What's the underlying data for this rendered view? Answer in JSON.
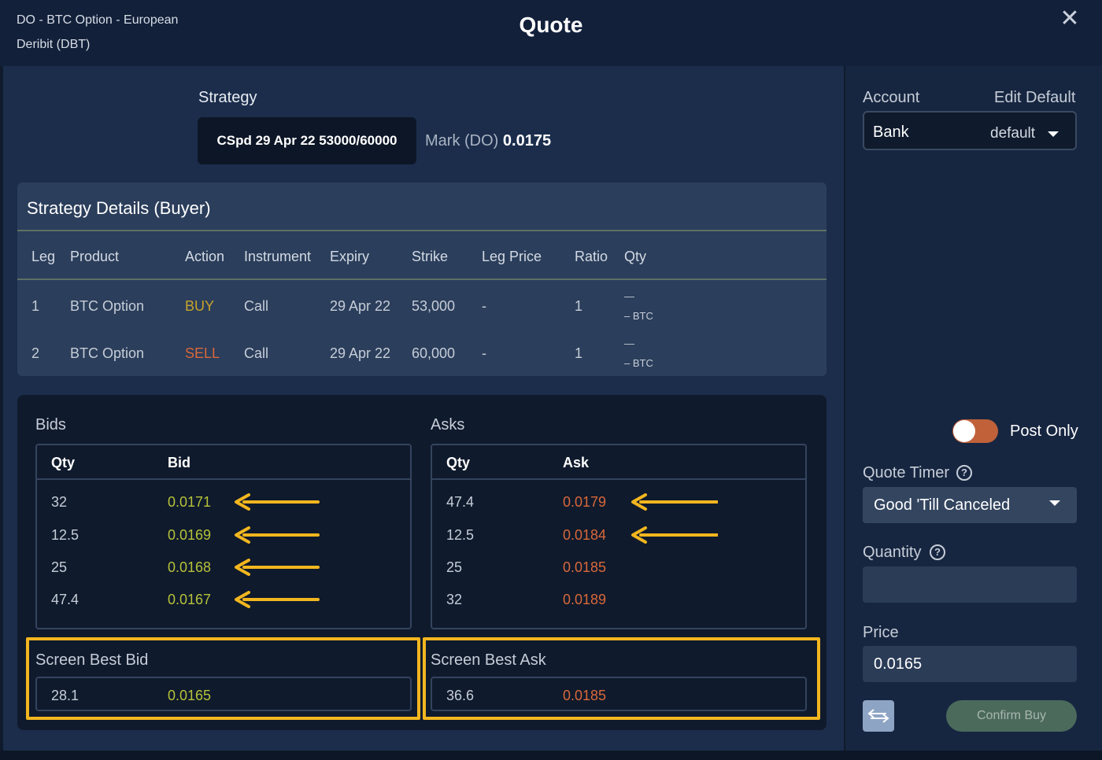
{
  "header": {
    "line1": "DO - BTC Option - European",
    "line2": "Deribit (DBT)",
    "title": "Quote",
    "close_icon": "close-icon"
  },
  "strategy": {
    "label": "Strategy",
    "name": "CSpd 29 Apr 22 53000/60000",
    "mark_label": "Mark (DO)",
    "mark_value": "0.0175"
  },
  "details": {
    "title": "Strategy Details (Buyer)",
    "columns": [
      "Leg",
      "Product",
      "Action",
      "Instrument",
      "Expiry",
      "Strike",
      "Leg Price",
      "Ratio",
      "Qty"
    ],
    "rows": [
      {
        "leg": "1",
        "product": "BTC Option",
        "action": "BUY",
        "instrument": "Call",
        "expiry": "29 Apr 22",
        "strike": "53,000",
        "leg_price": "-",
        "ratio": "1",
        "qty_top": "—",
        "qty_bottom": "– BTC"
      },
      {
        "leg": "2",
        "product": "BTC Option",
        "action": "SELL",
        "instrument": "Call",
        "expiry": "29 Apr 22",
        "strike": "60,000",
        "leg_price": "-",
        "ratio": "1",
        "qty_top": "—",
        "qty_bottom": "– BTC"
      }
    ]
  },
  "bids": {
    "title": "Bids",
    "qty_header": "Qty",
    "price_header": "Bid",
    "rows": [
      {
        "qty": "32",
        "price": "0.0171"
      },
      {
        "qty": "12.5",
        "price": "0.0169"
      },
      {
        "qty": "25",
        "price": "0.0168"
      },
      {
        "qty": "47.4",
        "price": "0.0167"
      }
    ]
  },
  "asks": {
    "title": "Asks",
    "qty_header": "Qty",
    "price_header": "Ask",
    "rows": [
      {
        "qty": "47.4",
        "price": "0.0179"
      },
      {
        "qty": "12.5",
        "price": "0.0184"
      },
      {
        "qty": "25",
        "price": "0.0185"
      },
      {
        "qty": "32",
        "price": "0.0189"
      }
    ]
  },
  "best_bid": {
    "label": "Screen Best Bid",
    "qty": "28.1",
    "price": "0.0165"
  },
  "best_ask": {
    "label": "Screen Best Ask",
    "qty": "36.6",
    "price": "0.0185"
  },
  "side": {
    "account_label": "Account",
    "edit_default": "Edit Default",
    "account_value": "Bank",
    "account_default": "default",
    "post_only": "Post Only",
    "post_only_on": true,
    "quote_timer_label": "Quote Timer",
    "quote_timer_value": "Good 'Till Canceled",
    "quantity_label": "Quantity",
    "quantity_value": "",
    "price_label": "Price",
    "price_value": "0.0165",
    "confirm_label": "Confirm Buy"
  },
  "colors": {
    "buy": "#c8a32b",
    "sell": "#d9683a",
    "bid_price": "#b6c23a",
    "ask_price": "#d9683a",
    "highlight": "#f2b61f",
    "toggle_on": "#c0613a"
  }
}
